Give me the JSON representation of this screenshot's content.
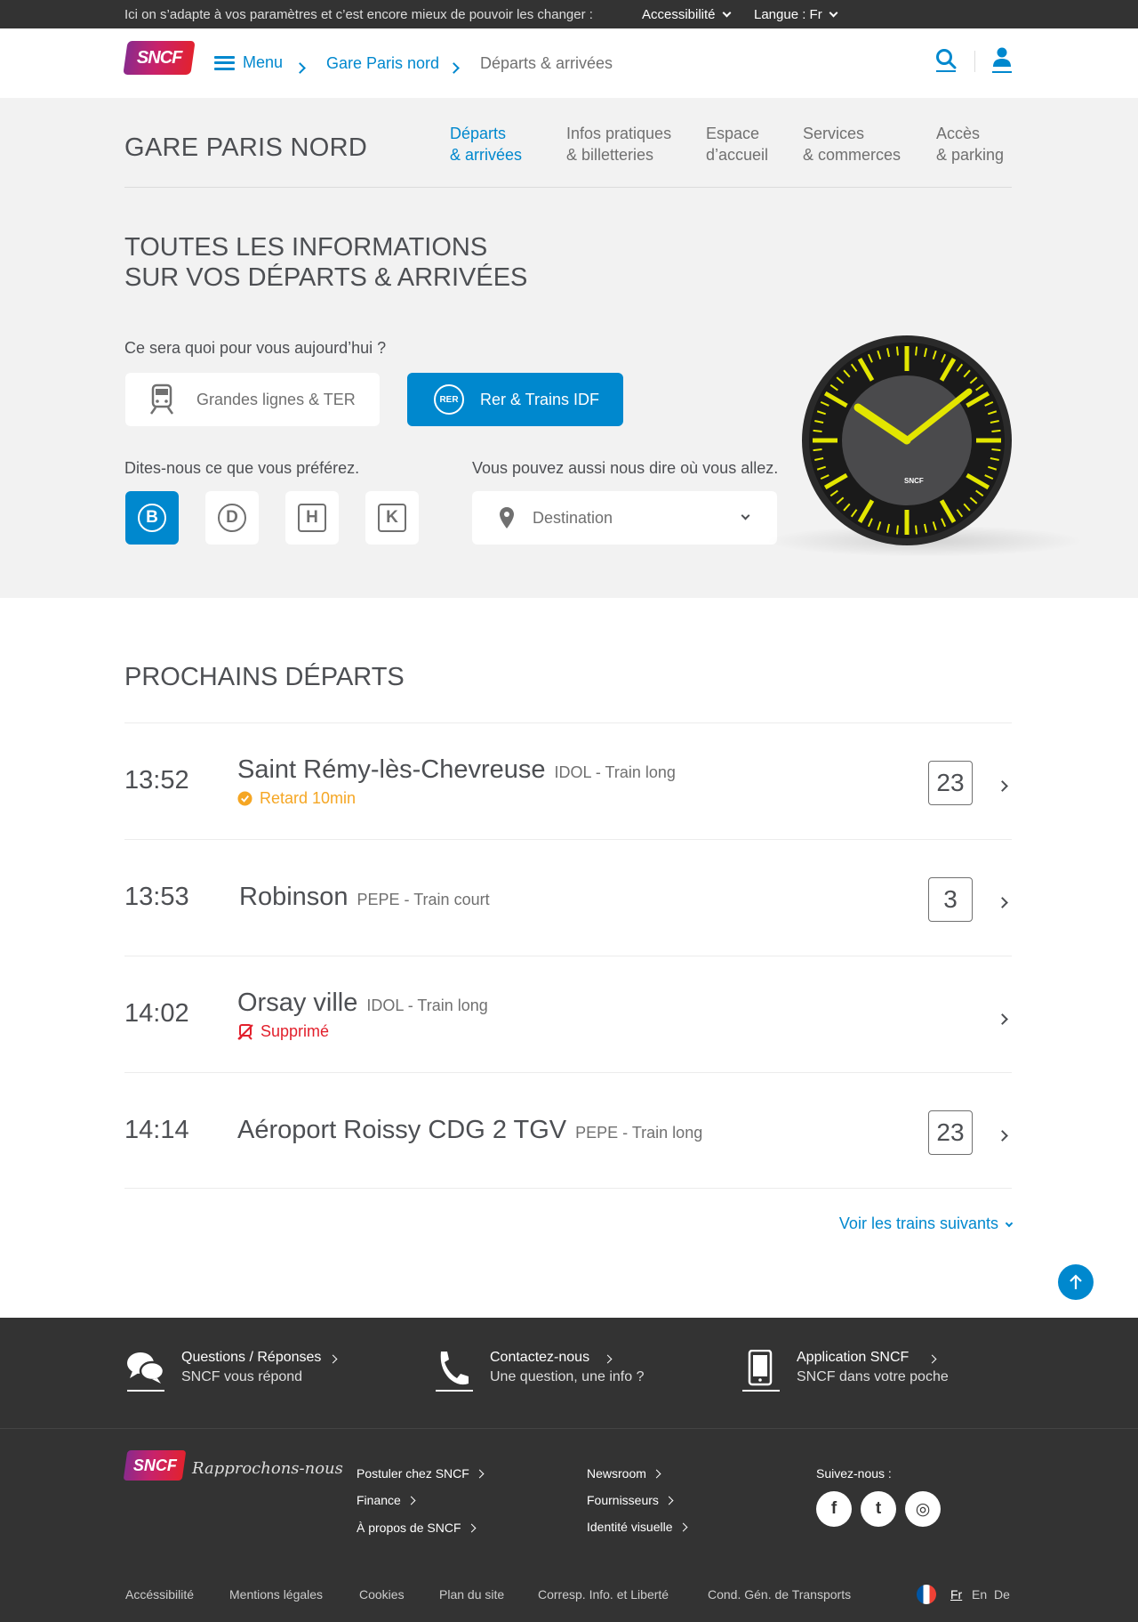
{
  "topbar": {
    "message": "Ici on s’adapte à vos paramètres et c’est encore mieux de pouvoir les changer :",
    "accessibility": "Accessibilité",
    "language": "Langue : Fr"
  },
  "header": {
    "logo": "SNCF",
    "menu_label": "Menu",
    "breadcrumb": [
      "Gare Paris nord",
      "Départs & arrivées"
    ],
    "icons": [
      "search-icon",
      "user-icon"
    ]
  },
  "station": {
    "name": "GARE PARIS NORD",
    "nav": [
      {
        "line1": "Départs",
        "line2": "& arrivées"
      },
      {
        "line1": "Infos pratiques",
        "line2": "& billetteries"
      },
      {
        "line1": "Espace",
        "line2": "d’accueil"
      },
      {
        "line1": "Services",
        "line2": "& commerces"
      },
      {
        "line1": "Accès",
        "line2": "& parking"
      }
    ]
  },
  "hero": {
    "title_line1": "TOUTES LES INFORMATIONS",
    "title_line2": "SUR VOS DÉPARTS & ARRIVÉES",
    "question": "Ce sera quoi pour vous aujourd’hui ?",
    "options": [
      "Grandes lignes & TER",
      "Rer & Trains IDF"
    ],
    "rer_badge": "RER",
    "prefer_label": "Dites-nous ce que vous préférez.",
    "lines": [
      "B",
      "D",
      "H",
      "K"
    ],
    "destination_label": "Vous pouvez aussi nous dire où vous allez.",
    "destination_placeholder": "Destination",
    "clock_brand": "SNCF",
    "colors": {
      "accent": "#0088ce",
      "clock_yellow": "#e3e600"
    }
  },
  "departures": {
    "title": "PROCHAINS DÉPARTS",
    "rows": [
      {
        "time": "13:52",
        "destination": "Saint Rémy-lès-Chevreuse",
        "type": "IDOL - Train long",
        "status": "Retard 10min",
        "status_kind": "delay",
        "track": "23"
      },
      {
        "time": "13:53",
        "destination": "Robinson",
        "type": "PEPE - Train court",
        "status": "",
        "status_kind": "",
        "track": "3"
      },
      {
        "time": "14:02",
        "destination": "Orsay ville",
        "type": "IDOL - Train long",
        "status": "Supprimé",
        "status_kind": "cancelled",
        "track": ""
      },
      {
        "time": "14:14",
        "destination": "Aéroport Roissy CDG 2 TGV",
        "type": "PEPE - Train long",
        "status": "",
        "status_kind": "",
        "track": "23"
      }
    ],
    "more": "Voir les trains suivants",
    "colors": {
      "delay": "#f5a623",
      "cancelled": "#e2202c"
    }
  },
  "footer_top": [
    {
      "title": "Questions / Réponses",
      "subtitle": "SNCF vous répond",
      "icon": "chat-icon"
    },
    {
      "title": "Contactez-nous",
      "subtitle": "Une question, une info ?",
      "icon": "phone-icon"
    },
    {
      "title": "Application SNCF",
      "subtitle": "SNCF dans votre poche",
      "icon": "mobile-icon"
    }
  ],
  "footer": {
    "logo": "SNCF",
    "tagline": "Rapprochons-nous",
    "col1": [
      "Postuler chez SNCF",
      "Finance",
      "À propos de SNCF"
    ],
    "col2": [
      "Newsroom",
      "Fournisseurs",
      "Identité visuelle"
    ],
    "follow": "Suivez-nous :",
    "social": [
      "f",
      "t",
      "◎"
    ],
    "bottom_links": [
      "Accéssibilité",
      "Mentions légales",
      "Cookies",
      "Plan du site",
      "Corresp. Info. et Liberté",
      "Cond. Gén. de Transports"
    ],
    "languages": [
      "Fr",
      "En",
      "De"
    ]
  }
}
